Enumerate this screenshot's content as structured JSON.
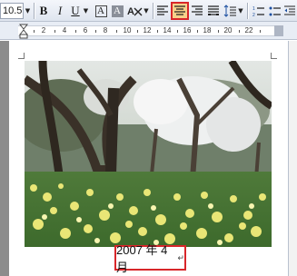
{
  "toolbar": {
    "font_size": "10.5",
    "bold": "B",
    "italic": "I",
    "underline": "U",
    "char_border": "A",
    "char_shading": "A",
    "align_center_active": true,
    "accent_color": "#d8262a"
  },
  "ruler": {
    "numbers": [
      "2",
      "4",
      "6",
      "8",
      "10",
      "12",
      "14",
      "16",
      "18",
      "20",
      "22"
    ]
  },
  "document": {
    "caption": "2007 年 4 月",
    "paragraph_mark": "↵"
  }
}
